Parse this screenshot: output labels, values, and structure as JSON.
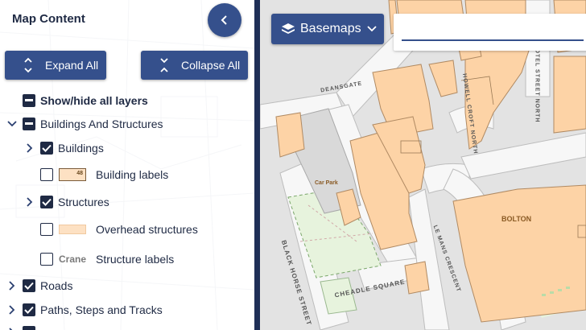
{
  "panel": {
    "title": "Map Content",
    "expand_all": "Expand All",
    "collapse_all": "Collapse All"
  },
  "layers": {
    "show_hide_all": "Show/hide all layers",
    "buildings_and_structures": "Buildings And Structures",
    "buildings": "Buildings",
    "building_labels": "Building labels",
    "building_labels_swatch": "48",
    "structures": "Structures",
    "overhead_structures": "Overhead structures",
    "structure_labels": "Structure labels",
    "structure_labels_sample": "Crane",
    "roads": "Roads",
    "paths": "Paths, Steps and Tracks"
  },
  "states": {
    "show_hide_all": "mixed",
    "buildings_and_structures": "mixed",
    "buildings": "checked",
    "building_labels": "unchecked",
    "structures": "checked",
    "overhead_structures": "unchecked",
    "structure_labels": "unchecked",
    "roads": "checked",
    "paths": "checked"
  },
  "map": {
    "basemaps_label": "Basemaps",
    "search_placeholder": "",
    "labels": {
      "bolton": "BOLTON",
      "car_park": "Car Park",
      "cheadle_square": "CHEADLE SQUARE",
      "black_horse_street": "BLACK HORSE STREET",
      "le_mans_crescent": "LE MANS CRESCENT",
      "howell_croft_north": "HOWELL CROFT NORTH",
      "deansgate": "DEANSGATE",
      "hotel_street_north": "HOTEL STREET NORTH"
    }
  },
  "colors": {
    "primary": "#35508c",
    "dark": "#1f2f57",
    "building_fill": "#fdd3a6",
    "building_stroke": "#c9a37a",
    "road": "#ffffff",
    "pavement": "#dcdcdc",
    "green": "#e6f3dc"
  },
  "icons": {
    "collapse_panel": "chevron-left-icon",
    "expand_all": "expand-arrows-icon",
    "collapse_all": "collapse-arrows-icon",
    "basemaps": "layers-icon",
    "basemaps_dropdown": "chevron-down-icon"
  }
}
